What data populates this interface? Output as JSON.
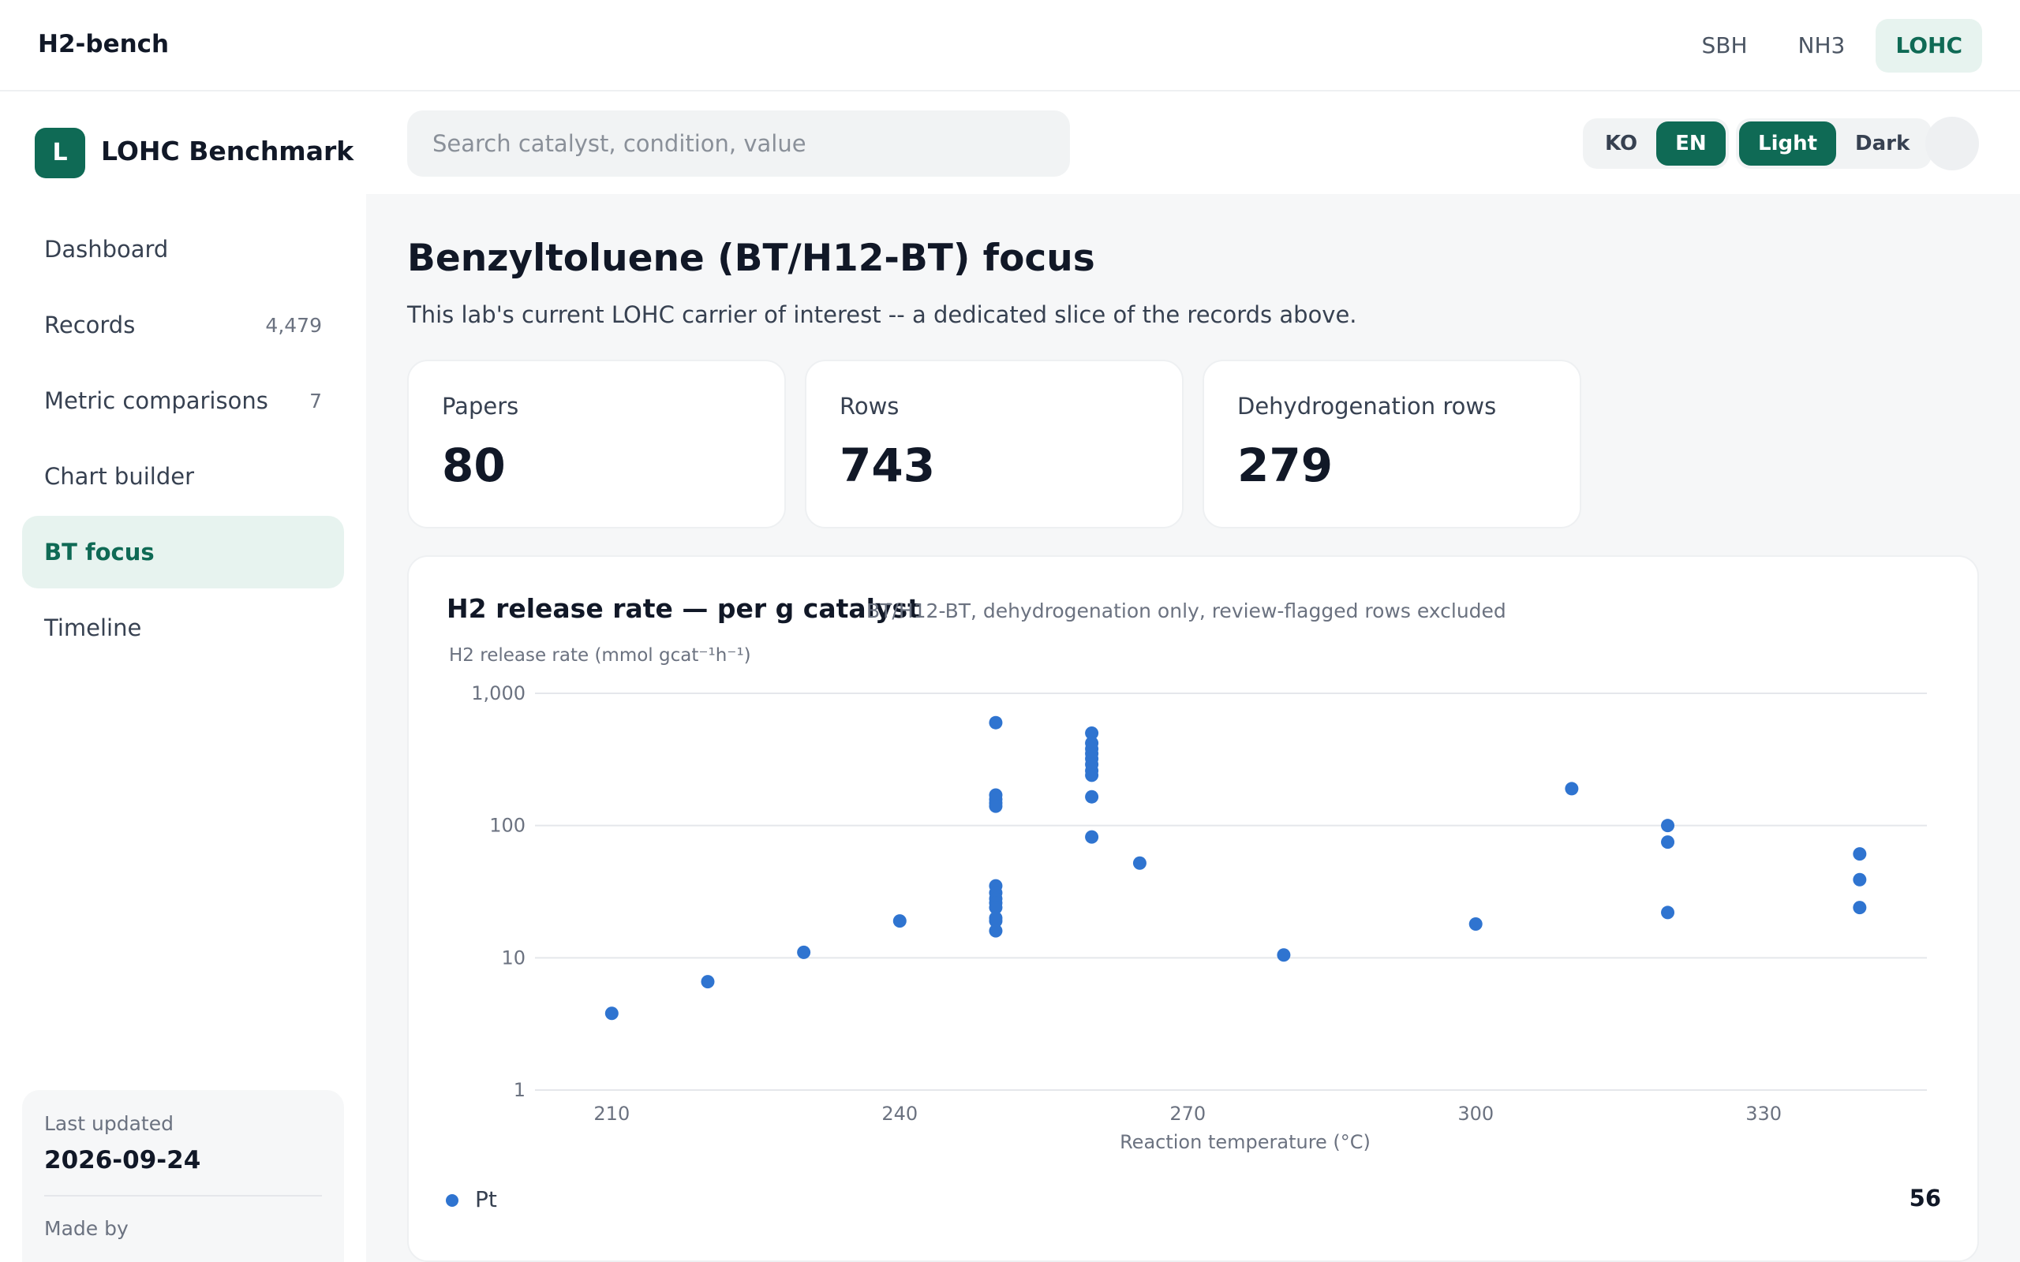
{
  "app": {
    "brand": "H2-bench"
  },
  "domain_tabs": [
    {
      "label": "SBH",
      "active": false
    },
    {
      "label": "NH3",
      "active": false
    },
    {
      "label": "LOHC",
      "active": true
    }
  ],
  "sidebar": {
    "logo_letter": "L",
    "title": "LOHC Benchmark",
    "items": [
      {
        "label": "Dashboard",
        "count": ""
      },
      {
        "label": "Records",
        "count": "4,479"
      },
      {
        "label": "Metric comparisons",
        "count": "7"
      },
      {
        "label": "Chart builder",
        "count": ""
      },
      {
        "label": "BT focus",
        "count": "",
        "active": true
      },
      {
        "label": "Timeline",
        "count": ""
      }
    ],
    "footer": {
      "updated_label": "Last updated",
      "updated_value": "2026-09-24",
      "made_by_label": "Made by"
    }
  },
  "toolbar": {
    "search_placeholder": "Search catalyst, condition, value",
    "lang": [
      {
        "label": "KO",
        "active": false
      },
      {
        "label": "EN",
        "active": true
      }
    ],
    "theme": [
      {
        "label": "Light",
        "active": true
      },
      {
        "label": "Dark",
        "active": false
      }
    ]
  },
  "page": {
    "title": "Benzyltoluene (BT/H12-BT) focus",
    "subtitle": "This lab's current LOHC carrier of interest -- a dedicated slice of the records above."
  },
  "stats": [
    {
      "label": "Papers",
      "value": "80"
    },
    {
      "label": "Rows",
      "value": "743"
    },
    {
      "label": "Dehydrogenation rows",
      "value": "279"
    }
  ],
  "chart_card": {
    "title": "H2 release rate — per g catalyst",
    "subtitle": "BT/H12-BT, dehydrogenation only, review-flagged rows excluded",
    "legend_count": "56"
  },
  "chart_data": {
    "type": "scatter",
    "title": "",
    "xlabel": "Reaction temperature (°C)",
    "ylabel": "H2 release rate (mmol gcat⁻¹h⁻¹)",
    "yscale": "log",
    "xlim": [
      202,
      347
    ],
    "ylim": [
      1,
      1000
    ],
    "x_ticks": [
      210,
      240,
      270,
      300,
      330
    ],
    "y_ticks": [
      1,
      10,
      100,
      1000
    ],
    "y_tick_labels": [
      "1",
      "10",
      "100",
      "1,000"
    ],
    "grid": "horizontal",
    "legend_position": "bottom-left",
    "series": [
      {
        "name": "Pt",
        "color": "#2f74d0",
        "points": [
          [
            210,
            3.8
          ],
          [
            220,
            6.6
          ],
          [
            230,
            11
          ],
          [
            240,
            19
          ],
          [
            250,
            600
          ],
          [
            250,
            170
          ],
          [
            250,
            158
          ],
          [
            250,
            148
          ],
          [
            250,
            140
          ],
          [
            250,
            35
          ],
          [
            250,
            31
          ],
          [
            250,
            28
          ],
          [
            250,
            26
          ],
          [
            250,
            24
          ],
          [
            250,
            20
          ],
          [
            250,
            19
          ],
          [
            250,
            16
          ],
          [
            260,
            500
          ],
          [
            260,
            420
          ],
          [
            260,
            380
          ],
          [
            260,
            350
          ],
          [
            260,
            320
          ],
          [
            260,
            290
          ],
          [
            260,
            260
          ],
          [
            260,
            240
          ],
          [
            260,
            165
          ],
          [
            260,
            82
          ],
          [
            265,
            52
          ],
          [
            280,
            10.5
          ],
          [
            300,
            18
          ],
          [
            310,
            190
          ],
          [
            320,
            100
          ],
          [
            320,
            75
          ],
          [
            320,
            22
          ],
          [
            340,
            61
          ],
          [
            340,
            39
          ],
          [
            340,
            24
          ]
        ]
      }
    ]
  }
}
